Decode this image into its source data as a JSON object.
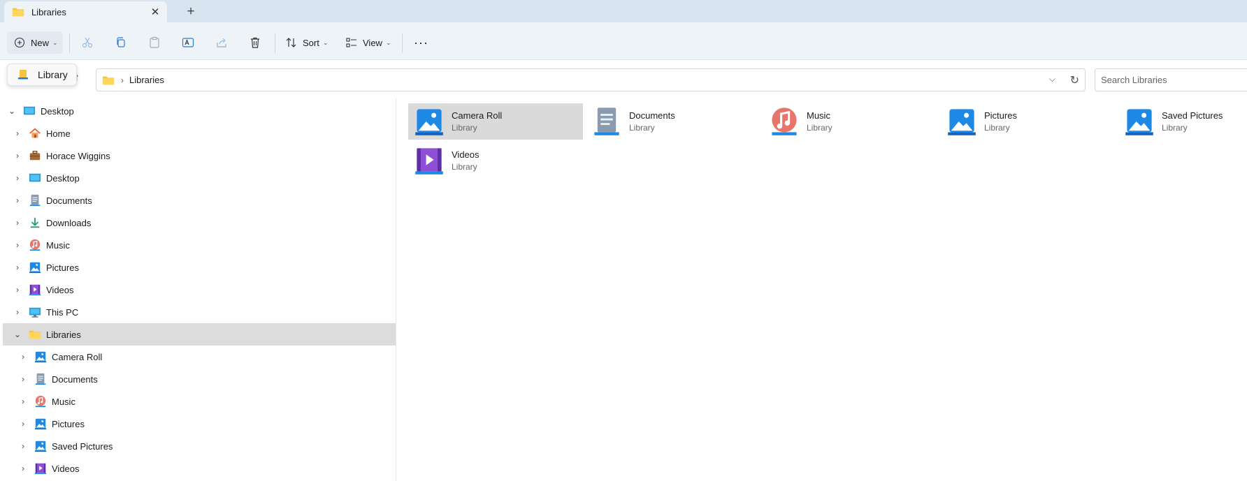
{
  "tab": {
    "title": "Libraries",
    "icon": "folder-icon"
  },
  "toolbar": {
    "new_label": "New",
    "sort_label": "Sort",
    "view_label": "View"
  },
  "tooltip": {
    "label": "Library"
  },
  "address": {
    "crumb": "Libraries"
  },
  "search": {
    "placeholder": "Search Libraries"
  },
  "nav": {
    "items": [
      {
        "label": "Desktop",
        "icon": "desktop-icon"
      },
      {
        "label": "Home",
        "icon": "home-icon"
      },
      {
        "label": "Horace Wiggins",
        "icon": "briefcase-icon"
      },
      {
        "label": "Desktop",
        "icon": "desktop-icon"
      },
      {
        "label": "Documents",
        "icon": "documents-icon"
      },
      {
        "label": "Downloads",
        "icon": "downloads-icon"
      },
      {
        "label": "Music",
        "icon": "music-icon"
      },
      {
        "label": "Pictures",
        "icon": "pictures-icon"
      },
      {
        "label": "Videos",
        "icon": "videos-icon"
      },
      {
        "label": "This PC",
        "icon": "pc-icon"
      },
      {
        "label": "Libraries",
        "icon": "folder-icon"
      },
      {
        "label": "Camera Roll",
        "icon": "pictures-icon"
      },
      {
        "label": "Documents",
        "icon": "documents-icon"
      },
      {
        "label": "Music",
        "icon": "music-icon"
      },
      {
        "label": "Pictures",
        "icon": "pictures-icon"
      },
      {
        "label": "Saved Pictures",
        "icon": "pictures-icon"
      },
      {
        "label": "Videos",
        "icon": "videos-icon"
      }
    ]
  },
  "content": {
    "items": [
      {
        "name": "Camera Roll",
        "type": "Library"
      },
      {
        "name": "Documents",
        "type": "Library"
      },
      {
        "name": "Music",
        "type": "Library"
      },
      {
        "name": "Pictures",
        "type": "Library"
      },
      {
        "name": "Saved Pictures",
        "type": "Library"
      },
      {
        "name": "Videos",
        "type": "Library"
      }
    ]
  }
}
